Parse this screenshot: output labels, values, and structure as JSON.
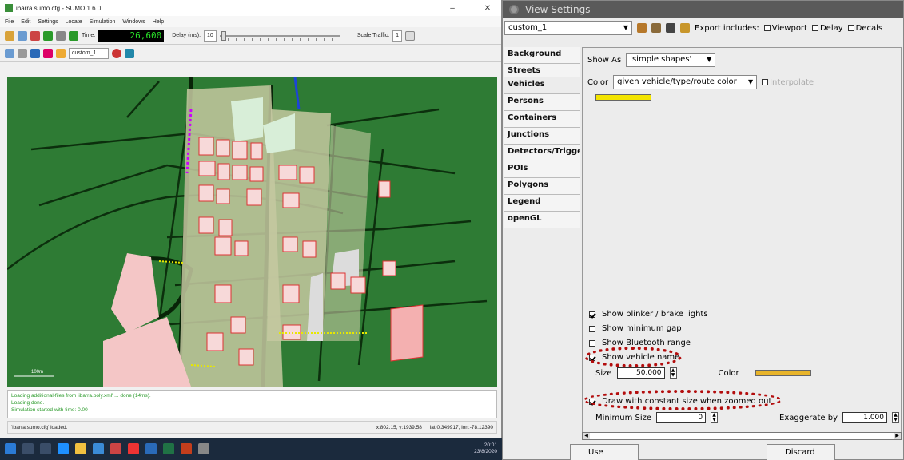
{
  "sumo": {
    "title": "ibarra.sumo.cfg - SUMO 1.6.0",
    "menu": [
      "File",
      "Edit",
      "Settings",
      "Locate",
      "Simulation",
      "Windows",
      "Help"
    ],
    "time_label": "Time:",
    "time_value": "26,600",
    "delay_label": "Delay (ms):",
    "delay_value": "10",
    "scale_label": "Scale Traffic:",
    "scale_value": "1",
    "scheme_value": "custom_1",
    "scale_bar": "100m",
    "log": [
      "Loading additional-files from 'ibarra.poly.xml' ... done (14ms).",
      "Loading done.",
      "Simulation started with time: 0.00"
    ],
    "status_left": "'ibarra.sumo.cfg' loaded.",
    "status_coords": "x:802.15, y:1939.58",
    "status_geo": "lat:0.349917, lon:-78.12390",
    "tray_time": "20:01",
    "tray_date": "23/8/2020",
    "colors": {
      "map": "#2e7b34",
      "road": "#0c2f0d"
    },
    "icons": [
      "open-icon",
      "reload-icon",
      "close-icon",
      "run-icon",
      "step-icon",
      "stop-icon",
      "grid-icon",
      "zoom-icon",
      "locate-icon",
      "color-icon",
      "flag-icon",
      "scheme-icon",
      "3d-icon"
    ]
  },
  "view_settings": {
    "title": "View Settings",
    "scheme": "custom_1",
    "export_label": "Export includes:",
    "export_options": [
      "Viewport",
      "Delay",
      "Decals"
    ],
    "tabs": [
      "Background",
      "Streets",
      "Vehicles",
      "Persons",
      "Containers",
      "Junctions",
      "Detectors/Trigger",
      "POIs",
      "Polygons",
      "Legend",
      "openGL"
    ],
    "selected_tab": "Vehicles",
    "show_as_label": "Show As",
    "show_as_value": "'simple shapes'",
    "color_label": "Color",
    "color_value": "given vehicle/type/route color",
    "interpolate_label": "Interpolate",
    "colors": {
      "swatch": "#f3e400",
      "name_color": "#e8b42a",
      "highlight": "#b30d0d"
    },
    "checkboxes": {
      "blinker": "Show blinker / brake lights",
      "min_gap": "Show minimum gap",
      "bluetooth": "Show Bluetooth range",
      "vehicle_name": "Show vehicle name",
      "constant_size": "Draw with constant size when zoomed out"
    },
    "size_label": "Size",
    "size_value": "50.000",
    "name_color_label": "Color",
    "min_size_label": "Minimum Size",
    "min_size_value": "0",
    "exaggerate_label": "Exaggerate by",
    "exaggerate_value": "1.000",
    "use_label": "Use",
    "discard_label": "Discard"
  }
}
